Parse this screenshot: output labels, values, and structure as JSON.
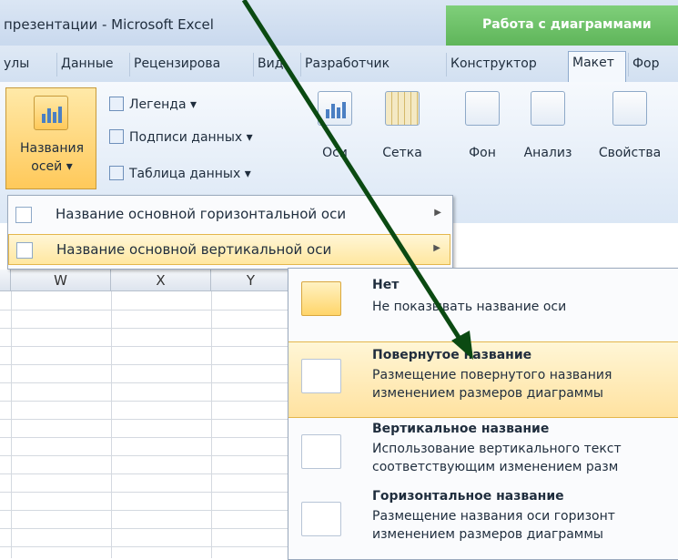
{
  "window": {
    "title": "презентации  -  Microsoft Excel"
  },
  "context_group": {
    "title": "Работа с диаграммами"
  },
  "tabs": [
    "улы",
    "Данные",
    "Рецензирова",
    "Вид",
    "Разработчик",
    "Конструктор",
    "Макет",
    "Фор"
  ],
  "ribbon": {
    "axis_titles_label_1": "Названия",
    "axis_titles_label_2": "осей ▾",
    "legend": "Легенда ▾",
    "data_labels": "Подписи данных ▾",
    "data_table": "Таблица данных ▾",
    "axes": "Оси",
    "gridlines": "Сетка",
    "background": "Фон",
    "analysis": "Анализ",
    "properties": "Свойства"
  },
  "submenu_axes": {
    "items": [
      {
        "label": "Название основной горизонтальной оси",
        "highlighted": false
      },
      {
        "label": "Название основной вертикальной оси",
        "highlighted": true
      }
    ]
  },
  "columns": [
    "W",
    "X",
    "Y"
  ],
  "vertical_axis_menu": {
    "items": [
      {
        "title": "Нет",
        "desc1": "Не показывать название оси",
        "desc2": ""
      },
      {
        "title": "Повернутое название",
        "desc1": "Размещение повернутого названия",
        "desc2": "изменением размеров диаграммы"
      },
      {
        "title": "Вертикальное название",
        "desc1": "Использование вертикального текст",
        "desc2": "соответствующим изменением разм"
      },
      {
        "title": "Горизонтальное название",
        "desc1": "Размещение названия оси горизонт",
        "desc2": "изменением размеров диаграммы"
      }
    ]
  },
  "colors": {
    "accent": "#ffd56a",
    "arrow": "#0b4a12",
    "context_tab": "#5fb55a"
  }
}
